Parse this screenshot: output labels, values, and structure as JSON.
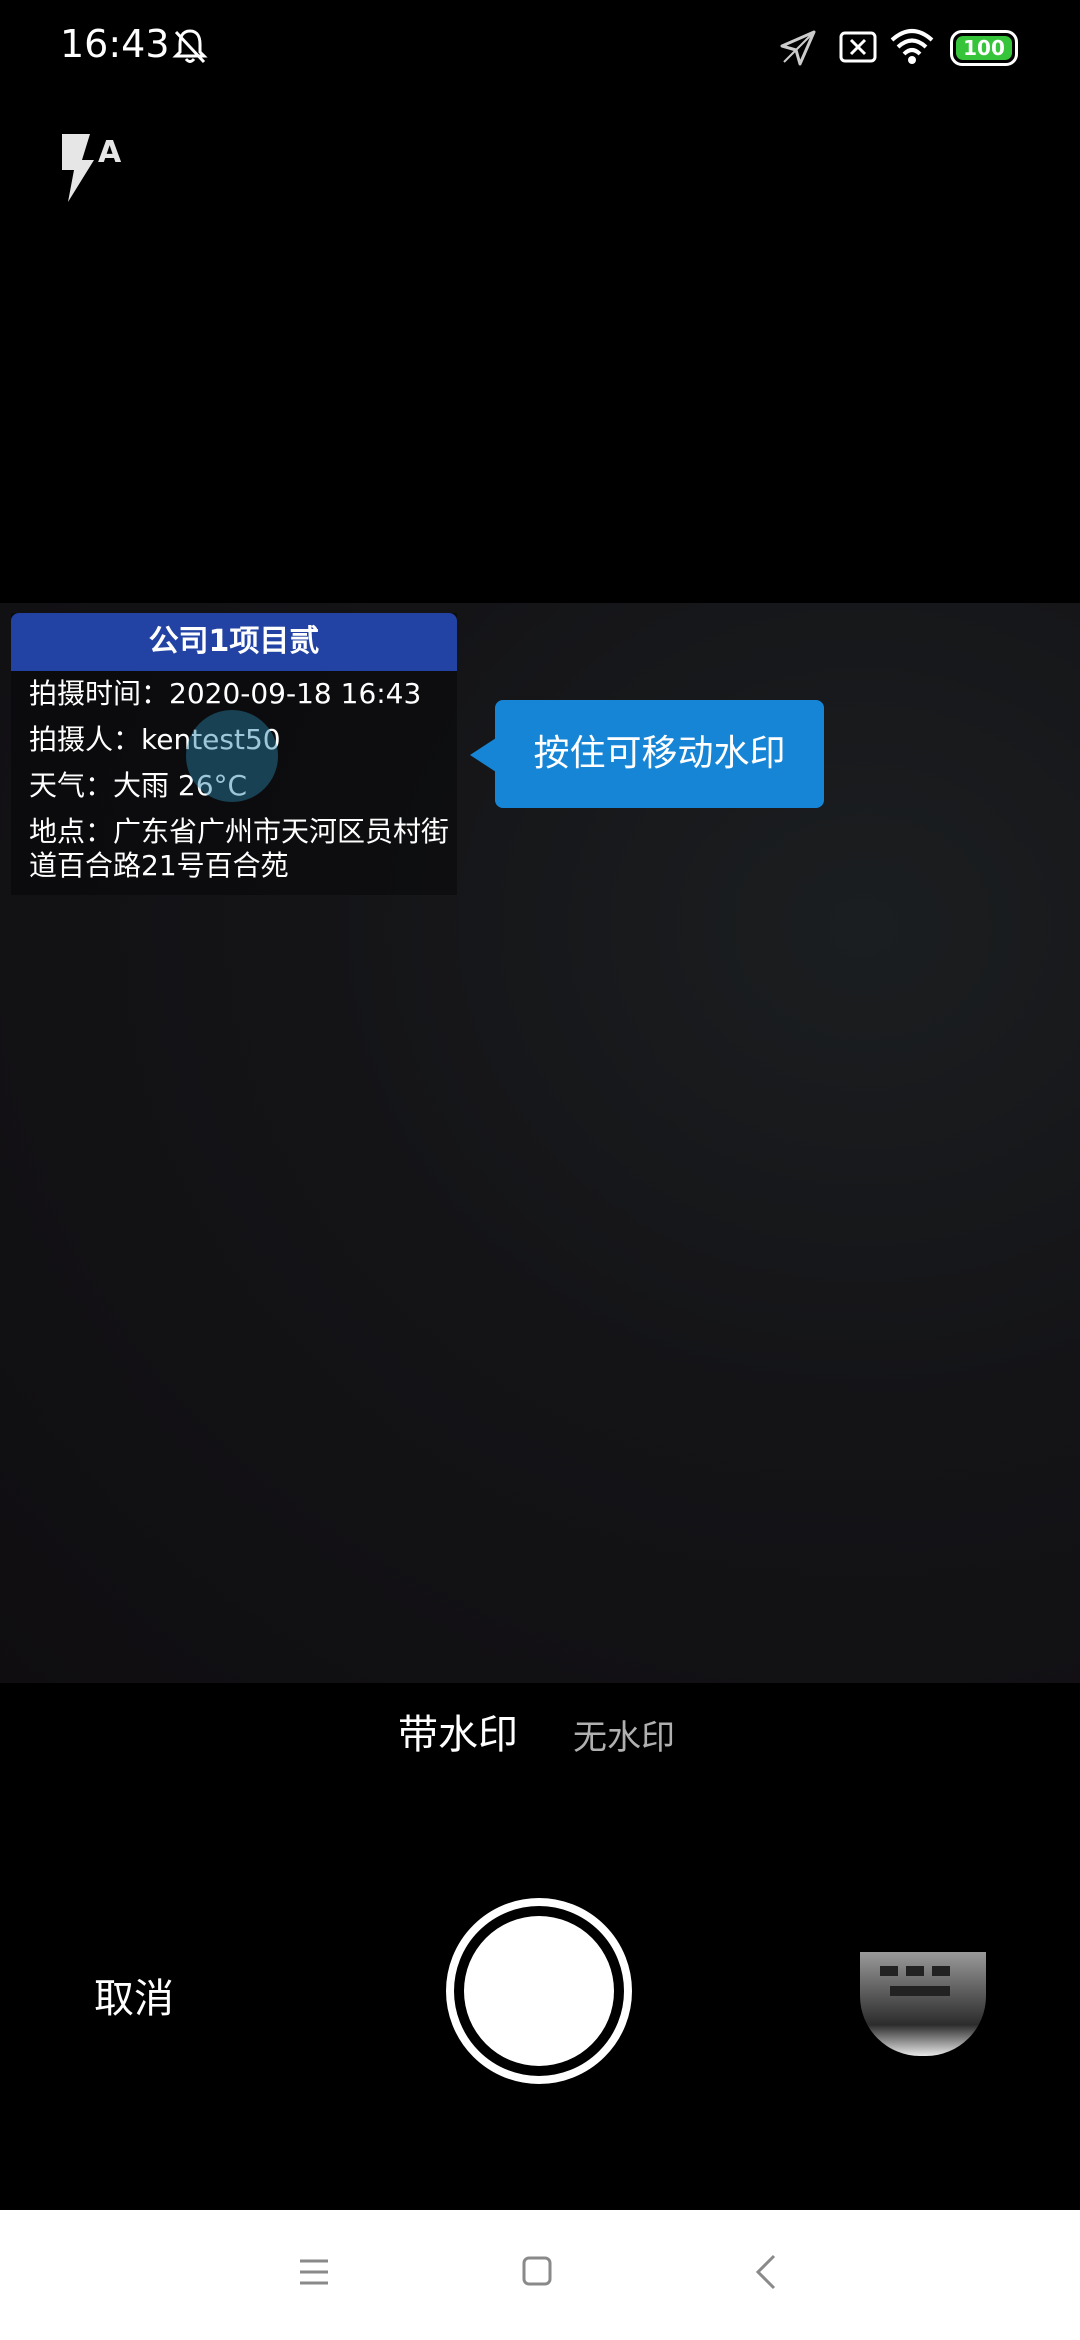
{
  "status_bar": {
    "time": "16:43",
    "battery_level": "100",
    "icons": [
      "bell-muted-icon",
      "location-arrow-icon",
      "sim-x-icon",
      "wifi-icon",
      "battery-icon"
    ],
    "battery_color": "#36c53a"
  },
  "flash": {
    "icon": "flash-auto-icon",
    "mode_letter": "A"
  },
  "watermark": {
    "title": "公司1项目贰",
    "time_line": "拍摄时间：2020-09-18 16:43",
    "person_line": "拍摄人：kentest50",
    "weather_line": "天气：大雨 26°C",
    "address_line": "地点：广东省广州市天河区员村街道百合路21号百合苑",
    "header_color": "#2243a3"
  },
  "tooltip": {
    "text": "按住可移动水印",
    "color": "#1685d6"
  },
  "mode": {
    "with_watermark": "带水印",
    "without_watermark": "无水印",
    "selected": "带水印"
  },
  "controls": {
    "cancel_label": "取消",
    "shutter_icon": "shutter-button",
    "gallery_icon": "gallery-thumbnail"
  },
  "nav_bar": {
    "icons": [
      "menu-icon",
      "home-icon",
      "back-icon"
    ]
  }
}
